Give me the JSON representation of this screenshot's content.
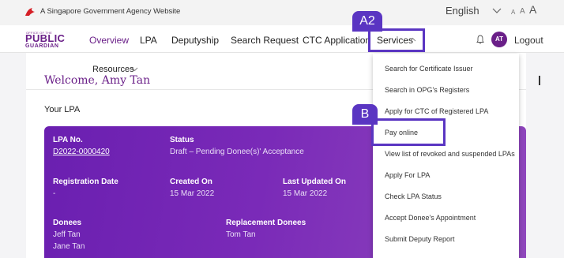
{
  "gov_bar": {
    "agency_text": "A Singapore Government Agency Website",
    "language": "English",
    "font_sizes": [
      "A",
      "A",
      "A"
    ]
  },
  "nav": {
    "logo": {
      "small": "OFFICE OF THE",
      "public": "PUBLIC",
      "guardian": "GUARDIAN"
    },
    "items": [
      "Overview",
      "LPA",
      "Deputyship",
      "Search Request",
      "CTC Application",
      "Services"
    ],
    "avatar_initials": "AT",
    "logout": "Logout"
  },
  "main": {
    "resources": "Resources",
    "welcome": "Welcome, Amy Tan",
    "your_lpa": "Your LPA"
  },
  "lpa_card": {
    "lpa_no_label": "LPA No.",
    "lpa_no": "D2022-0000420",
    "status_label": "Status",
    "status": "Draft – Pending Donee(s)' Acceptance",
    "registration_date_label": "Registration Date",
    "registration_date": "-",
    "created_on_label": "Created On",
    "created_on": "15 Mar 2022",
    "last_updated_label": "Last Updated On",
    "last_updated": "15 Mar 2022",
    "donees_label": "Donees",
    "donees": [
      "Jeff Tan",
      "Jane Tan"
    ],
    "replacement_donees_label": "Replacement Donees",
    "replacement_donees": [
      "Tom Tan"
    ]
  },
  "services_menu": [
    "Search for Certificate Issuer",
    "Search in OPG's Registers",
    "Apply for CTC of Registered LPA",
    "Pay online",
    "View list of revoked and suspended LPAs",
    "Apply For LPA",
    "Check LPA Status",
    "Accept Donee's Appointment",
    "Submit Deputy Report"
  ],
  "annotations": {
    "a2": "A2",
    "b": "B"
  },
  "colors": {
    "brand_purple": "#6a1f88",
    "annotation": "#5a35c2"
  }
}
